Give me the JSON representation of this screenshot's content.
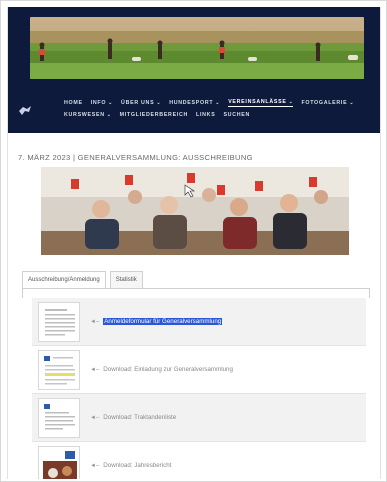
{
  "nav": {
    "row1": [
      {
        "label": "HOME",
        "dropdown": false,
        "active": false
      },
      {
        "label": "INFO",
        "dropdown": true,
        "active": false
      },
      {
        "label": "ÜBER UNS",
        "dropdown": true,
        "active": false
      },
      {
        "label": "HUNDESPORT",
        "dropdown": true,
        "active": false
      },
      {
        "label": "VEREINSANLÄSSE",
        "dropdown": true,
        "active": true
      },
      {
        "label": "FOTOGALERIE",
        "dropdown": true,
        "active": false
      }
    ],
    "row2": [
      {
        "label": "KURSWESEN",
        "dropdown": true,
        "active": false
      },
      {
        "label": "MITGLIEDERBEREICH",
        "dropdown": false,
        "active": false
      },
      {
        "label": "LINKS",
        "dropdown": false,
        "active": false
      },
      {
        "label": "SUCHEN",
        "dropdown": false,
        "active": false
      }
    ],
    "chevron": "⌄"
  },
  "post": {
    "title": "7. MÄRZ 2023 | GENERALVERSAMMLUNG: AUSSCHREIBUNG"
  },
  "tabs": [
    {
      "label": "Ausschreibung/Anmeldung",
      "active": true
    },
    {
      "label": "Statistik",
      "active": false
    }
  ],
  "documents": [
    {
      "arrow": "◄–",
      "label": "Anmeldeformular für Generalversammlung",
      "selected": true,
      "thumb": "form-thumbnail"
    },
    {
      "arrow": "◄–",
      "label": "Download: Einladung zur Generalversammlung",
      "selected": false,
      "thumb": "letter-thumbnail"
    },
    {
      "arrow": "◄–",
      "label": "Download: Traktandenliste",
      "selected": false,
      "thumb": "agenda-thumbnail"
    },
    {
      "arrow": "◄–",
      "label": "Download: Jahresbericht",
      "selected": false,
      "thumb": "report-thumbnail"
    }
  ],
  "colors": {
    "header_bg": "#0e1a3c",
    "selection": "#2b56d6"
  }
}
